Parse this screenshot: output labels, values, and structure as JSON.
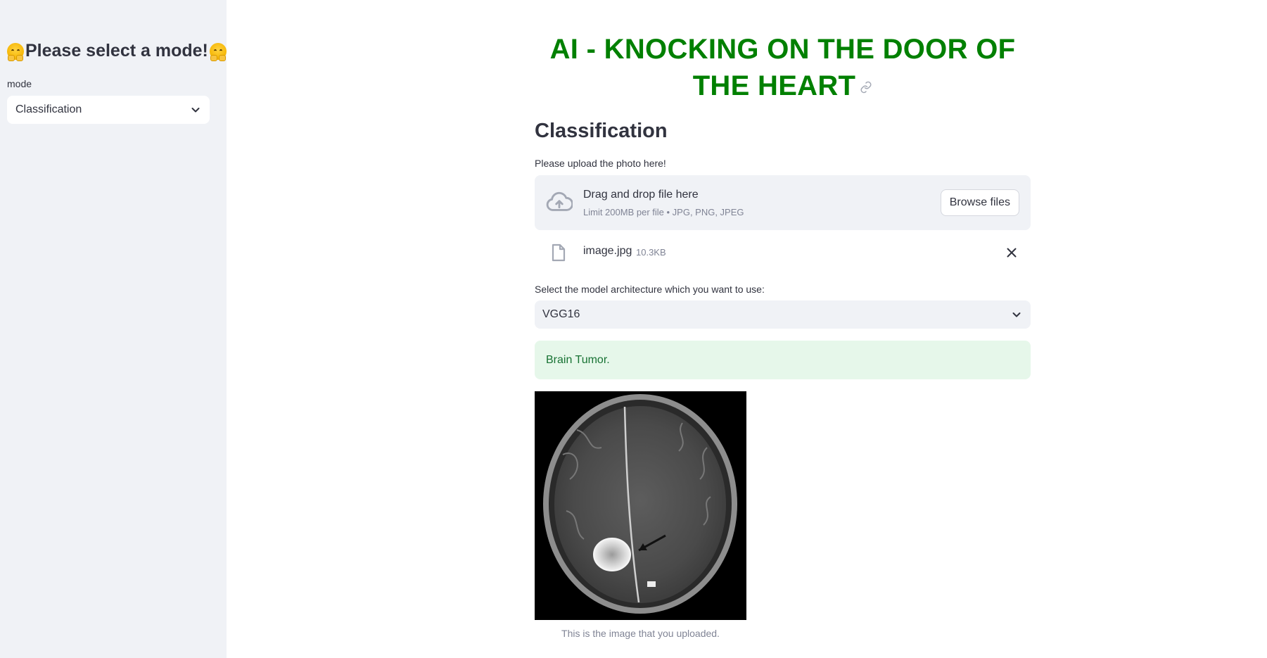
{
  "sidebar": {
    "title": "Please select a mode!",
    "mode_label": "mode",
    "mode_value": "Classification",
    "emoji_icon": "hugging-face-emoji"
  },
  "main": {
    "title": "AI - KNOCKING ON THE DOOR OF THE HEART",
    "title_color": "#008000",
    "section_heading": "Classification",
    "upload": {
      "label": "Please upload the photo here!",
      "dropzone_text": "Drag and drop file here",
      "dropzone_limit": "Limit 200MB per file • JPG, PNG, JPEG",
      "browse_label": "Browse files"
    },
    "uploaded_file": {
      "name": "image.jpg",
      "size": "10.3KB"
    },
    "model": {
      "label": "Select the model architecture which you want to use:",
      "value": "VGG16"
    },
    "result": "Brain Tumor.",
    "image_caption": "This is the image that you uploaded."
  },
  "colors": {
    "sidebar_bg": "#f0f2f6",
    "success_bg": "#e6f7ea",
    "success_text": "#177233"
  }
}
